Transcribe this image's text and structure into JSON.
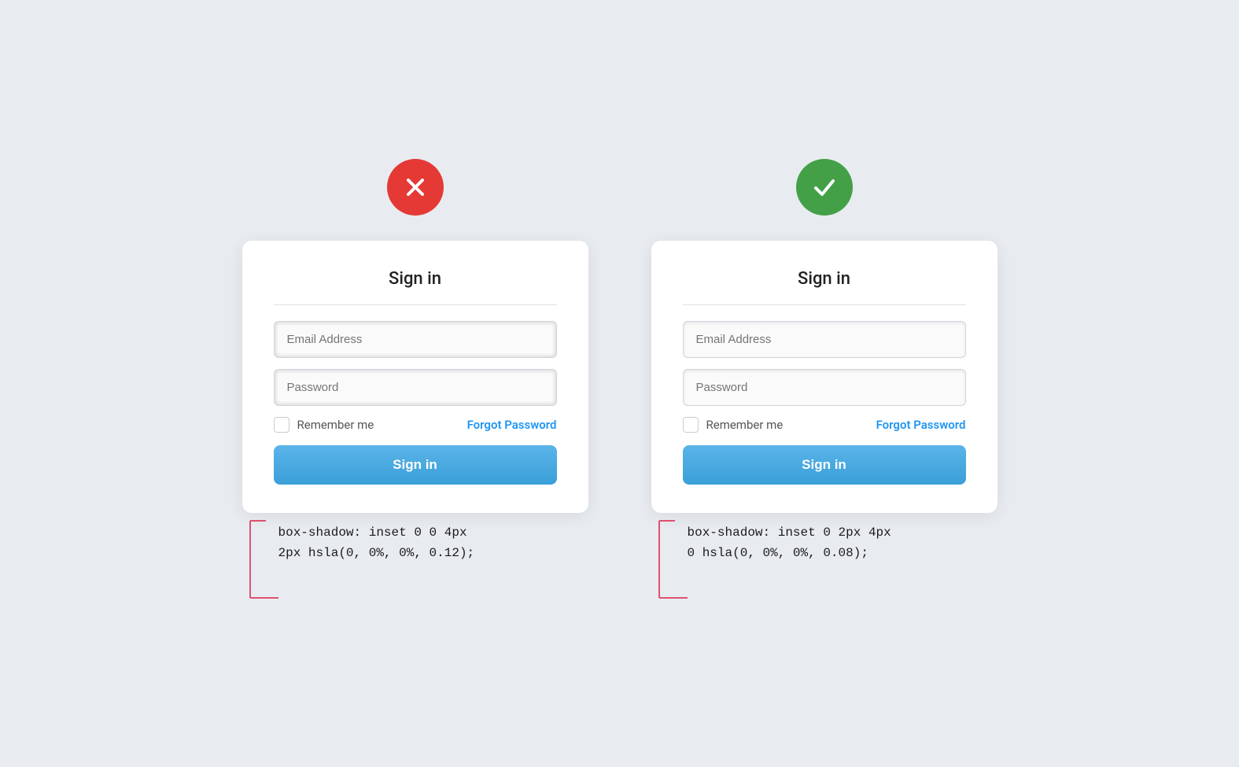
{
  "page": {
    "background": "#e8ecf0"
  },
  "bad_panel": {
    "badge_type": "bad",
    "card": {
      "title": "Sign in",
      "email_placeholder": "Email Address",
      "password_placeholder": "Password",
      "remember_label": "Remember me",
      "forgot_label": "Forgot Password",
      "sign_in_label": "Sign in"
    },
    "annotation_code_line1": "box-shadow: inset 0 0 4px",
    "annotation_code_line2": "2px hsla(0, 0%, 0%, 0.12);"
  },
  "good_panel": {
    "badge_type": "good",
    "card": {
      "title": "Sign in",
      "email_placeholder": "Email Address",
      "password_placeholder": "Password",
      "remember_label": "Remember me",
      "forgot_label": "Forgot Password",
      "sign_in_label": "Sign in"
    },
    "annotation_code_line1": "box-shadow: inset 0 2px 4px",
    "annotation_code_line2": "0 hsla(0, 0%, 0%, 0.08);"
  }
}
